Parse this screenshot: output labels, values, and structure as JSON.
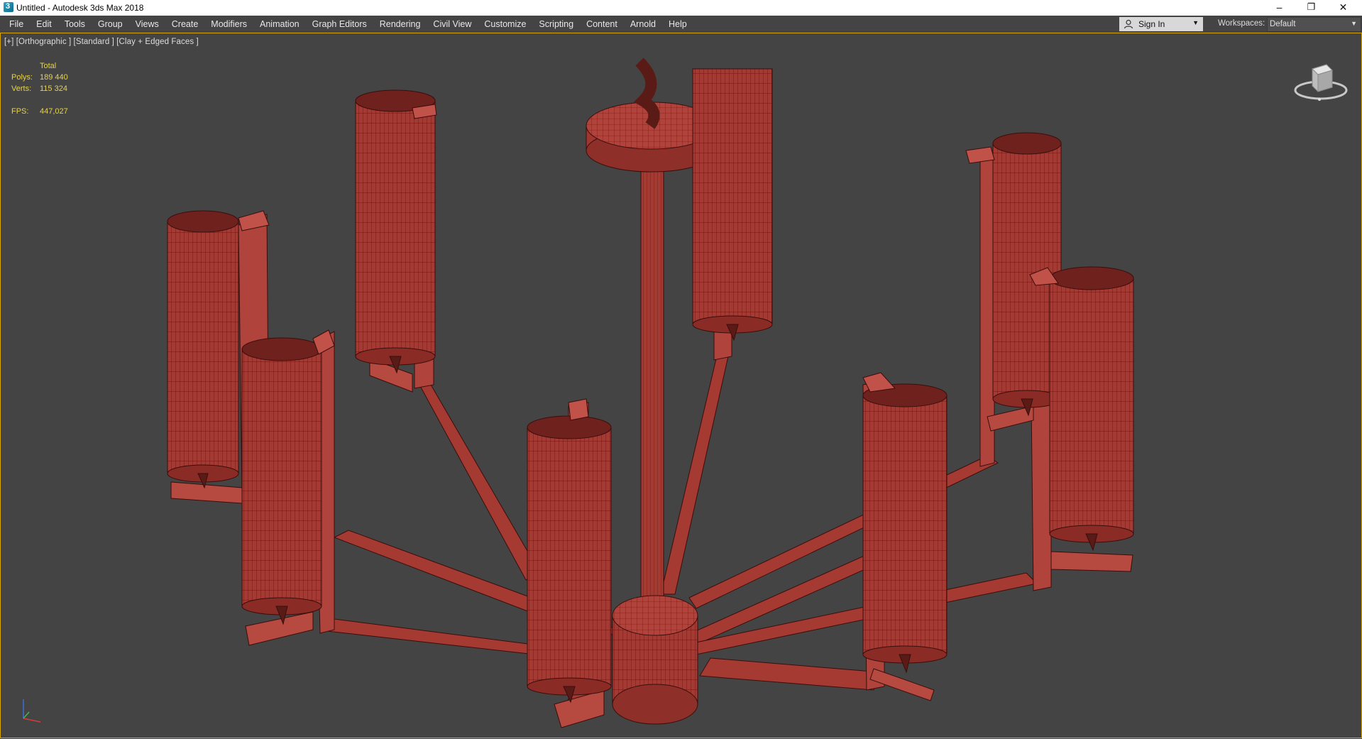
{
  "window": {
    "title": "Untitled - Autodesk 3ds Max 2018",
    "minimize": "–",
    "maximize": "❐",
    "close": "✕"
  },
  "menu": [
    "File",
    "Edit",
    "Tools",
    "Group",
    "Views",
    "Create",
    "Modifiers",
    "Animation",
    "Graph Editors",
    "Rendering",
    "Civil View",
    "Customize",
    "Scripting",
    "Content",
    "Arnold",
    "Help"
  ],
  "account": {
    "sign_in_label": "Sign In",
    "dropdown_arrow": "▼"
  },
  "workspaces": {
    "label": "Workspaces:",
    "value": "Default",
    "arrow": "▼"
  },
  "viewport": {
    "label": "[+] [Orthographic ] [Standard ] [Clay + Edged Faces ]",
    "stats": {
      "total_label": "Total",
      "polys_label": "Polys:",
      "polys_value": "189 440",
      "verts_label": "Verts:",
      "verts_value": "115 324",
      "fps_label": "FPS:",
      "fps_value": "447,027"
    }
  },
  "colors": {
    "viewport_bg": "#444444",
    "model_fill": "#a53a33",
    "model_dark": "#6e211d",
    "model_light": "#c0524a",
    "wire": "#3a0e0c",
    "stats_text": "#e6d34d",
    "accent_border": "#d8a400"
  },
  "icons": {
    "app": "3ds-max-app-icon",
    "user": "user-icon",
    "viewcube": "viewcube-icon",
    "axis": "axis-tripod-icon"
  }
}
